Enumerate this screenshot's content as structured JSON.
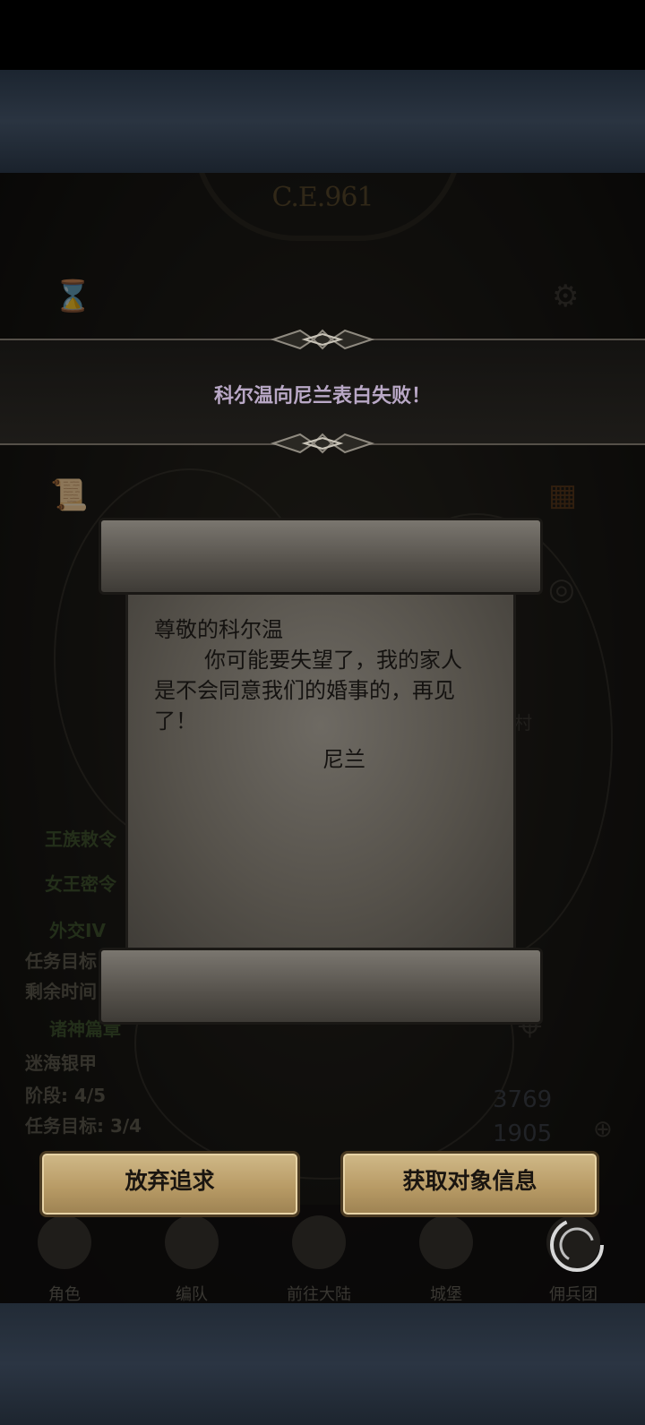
{
  "game": {
    "year": "C.E.961",
    "notification": "科尔温向尼兰表白失败！",
    "letter": {
      "salutation": "尊敬的科尔温",
      "body": "你可能要失望了，我的家人是不会同意我们的婚事的，再见了！",
      "signature": "尼兰"
    },
    "quests": [
      {
        "label": "王族敕令"
      },
      {
        "label": "女王密令"
      },
      {
        "label": "外交IV"
      },
      {
        "label": "任务目标"
      },
      {
        "label": "剩余时间"
      },
      {
        "label": "诸神篇章"
      },
      {
        "label": "迷海银甲"
      },
      {
        "label": "阶段: 4/5"
      },
      {
        "label": "任务目标: 3/4"
      }
    ],
    "resources": {
      "gems": "3769",
      "crystals": "1905"
    },
    "buttons": {
      "abandon": "放弃追求",
      "get_info": "获取对象信息"
    },
    "nav": [
      "角色",
      "编队",
      "前往大陆",
      "城堡",
      "佣兵团"
    ],
    "map_label": "村"
  }
}
